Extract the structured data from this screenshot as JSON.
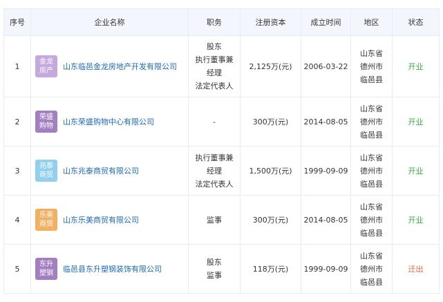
{
  "headers": [
    "序号",
    "企业名称",
    "职务",
    "注册资本",
    "成立时间",
    "地区",
    "状态"
  ],
  "rows": [
    {
      "index": "1",
      "logo_lines": [
        "金龙",
        "房产"
      ],
      "logo_color": "#c5a8de",
      "company": "山东临邑金龙房地产开发有限公司",
      "roles": [
        "股东",
        "执行董事兼",
        "经理",
        "法定代表人"
      ],
      "capital": "2,125万(元)",
      "date": "2006-03-22",
      "region": [
        "山东省",
        "德州市",
        "临邑县"
      ],
      "status": "开业",
      "status_color": "#3ea548"
    },
    {
      "index": "2",
      "logo_lines": [
        "荣盛",
        "购物"
      ],
      "logo_color": "#a27fc0",
      "company": "山东荣盛购物中心有限公司",
      "roles": [
        "-"
      ],
      "capital": "300万(元)",
      "date": "2014-08-05",
      "region": [
        "山东省",
        "德州市",
        "临邑县"
      ],
      "status": "开业",
      "status_color": "#3ea548"
    },
    {
      "index": "3",
      "logo_lines": [
        "兆泰",
        "商贸"
      ],
      "logo_color": "#92d0ef",
      "company": "山东兆泰商贸有限公司",
      "roles": [
        "执行董事兼",
        "经理",
        "法定代表人"
      ],
      "capital": "1,500万(元)",
      "date": "1999-09-09",
      "region": [
        "山东省",
        "德州市",
        "临邑县"
      ],
      "status": "开业",
      "status_color": "#3ea548"
    },
    {
      "index": "4",
      "logo_lines": [
        "乐美",
        "商贸"
      ],
      "logo_color": "#f2b063",
      "company": "山东乐美商贸有限公司",
      "roles": [
        "监事"
      ],
      "capital": "300万(元)",
      "date": "2014-08-05",
      "region": [
        "山东省",
        "德州市",
        "临邑县"
      ],
      "status": "开业",
      "status_color": "#3ea548"
    },
    {
      "index": "5",
      "logo_lines": [
        "东升",
        "塑钢"
      ],
      "logo_color": "#a27fc0",
      "company": "临邑县东升塑钢装饰有限公司",
      "roles": [
        "股东",
        "监事"
      ],
      "capital": "118万(元)",
      "date": "1999-09-09",
      "region": [
        "山东省",
        "德州市",
        "临邑县"
      ],
      "status": "迁出",
      "status_color": "#e0663c"
    }
  ]
}
